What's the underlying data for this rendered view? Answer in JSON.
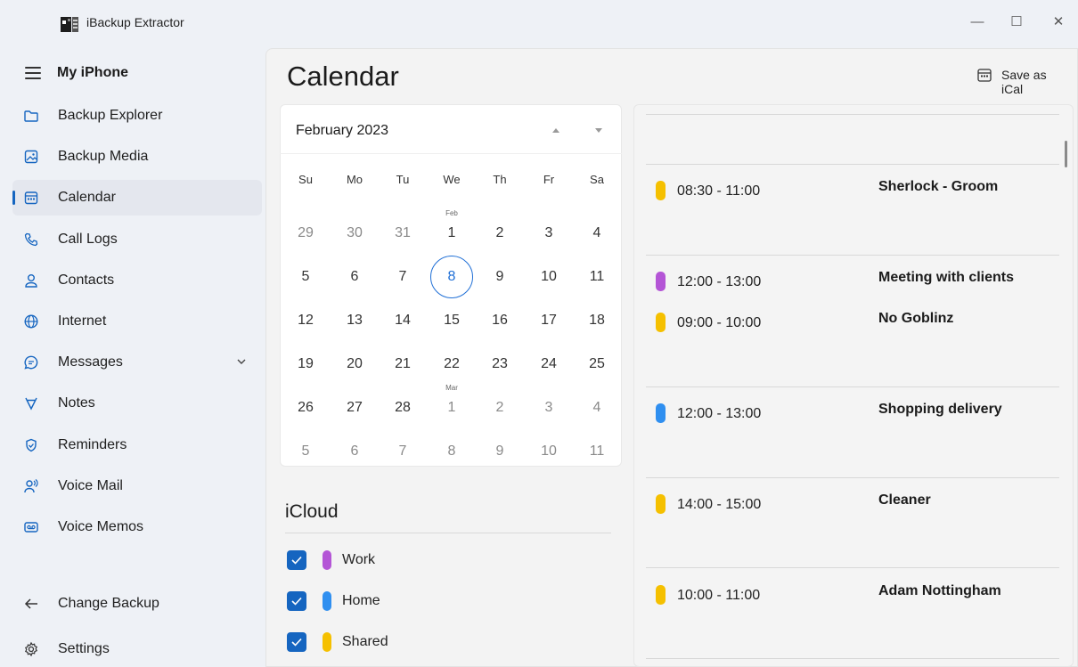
{
  "window": {
    "title": "iBackup Extractor",
    "controls": {
      "minimize": "—",
      "maximize": "☐",
      "close": "✕"
    }
  },
  "sidebar": {
    "device_name": "My iPhone",
    "items": [
      {
        "label": "Backup Explorer",
        "icon": "folder-icon"
      },
      {
        "label": "Backup Media",
        "icon": "image-icon"
      },
      {
        "label": "Calendar",
        "icon": "calendar-icon",
        "selected": true
      },
      {
        "label": "Call Logs",
        "icon": "phone-icon"
      },
      {
        "label": "Contacts",
        "icon": "person-icon"
      },
      {
        "label": "Internet",
        "icon": "globe-icon"
      },
      {
        "label": "Messages",
        "icon": "chat-icon",
        "expandable": true
      },
      {
        "label": "Notes",
        "icon": "notes-icon"
      },
      {
        "label": "Reminders",
        "icon": "reminder-icon"
      },
      {
        "label": "Voice Mail",
        "icon": "voicemail-icon"
      },
      {
        "label": "Voice Memos",
        "icon": "tape-icon"
      }
    ],
    "footer": {
      "change_backup": "Change Backup",
      "settings": "Settings"
    }
  },
  "main": {
    "title": "Calendar",
    "save_button": "Save as iCal"
  },
  "calendar": {
    "month_label": "February 2023",
    "weekdays": [
      "Su",
      "Mo",
      "Tu",
      "We",
      "Th",
      "Fr",
      "Sa"
    ],
    "weeks": [
      [
        {
          "d": "29",
          "o": true
        },
        {
          "d": "30",
          "o": true
        },
        {
          "d": "31",
          "o": true
        },
        {
          "d": "1",
          "m": "Feb"
        },
        {
          "d": "2"
        },
        {
          "d": "3"
        },
        {
          "d": "4"
        }
      ],
      [
        {
          "d": "5"
        },
        {
          "d": "6"
        },
        {
          "d": "7"
        },
        {
          "d": "8",
          "today": true
        },
        {
          "d": "9"
        },
        {
          "d": "10"
        },
        {
          "d": "11"
        }
      ],
      [
        {
          "d": "12"
        },
        {
          "d": "13"
        },
        {
          "d": "14"
        },
        {
          "d": "15"
        },
        {
          "d": "16"
        },
        {
          "d": "17"
        },
        {
          "d": "18"
        }
      ],
      [
        {
          "d": "19"
        },
        {
          "d": "20"
        },
        {
          "d": "21"
        },
        {
          "d": "22"
        },
        {
          "d": "23"
        },
        {
          "d": "24"
        },
        {
          "d": "25"
        }
      ],
      [
        {
          "d": "26"
        },
        {
          "d": "27"
        },
        {
          "d": "28"
        },
        {
          "d": "1",
          "m": "Mar",
          "o": true
        },
        {
          "d": "2",
          "o": true
        },
        {
          "d": "3",
          "o": true
        },
        {
          "d": "4",
          "o": true
        }
      ],
      [
        {
          "d": "5",
          "o": true
        },
        {
          "d": "6",
          "o": true
        },
        {
          "d": "7",
          "o": true
        },
        {
          "d": "8",
          "o": true
        },
        {
          "d": "9",
          "o": true
        },
        {
          "d": "10",
          "o": true
        },
        {
          "d": "11",
          "o": true
        }
      ]
    ]
  },
  "calendars_group": {
    "title": "iCloud",
    "items": [
      {
        "name": "Work",
        "color": "#b455d6",
        "checked": true
      },
      {
        "name": "Home",
        "color": "#2f8ff0",
        "checked": true
      },
      {
        "name": "Shared",
        "color": "#f5c000",
        "checked": true
      }
    ]
  },
  "events": [
    {
      "time": "08:30 - 11:00",
      "title": "Sherlock - Groom",
      "color": "#f5c000"
    },
    {
      "time": "12:00 - 13:00",
      "title": "Meeting with clients",
      "color": "#b455d6"
    },
    {
      "time": "09:00 - 10:00",
      "title": "No Goblinz",
      "color": "#f5c000"
    },
    {
      "time": "12:00 - 13:00",
      "title": "Shopping delivery",
      "color": "#2f8ff0"
    },
    {
      "time": "14:00 - 15:00",
      "title": "Cleaner",
      "color": "#f5c000"
    },
    {
      "time": "10:00 - 11:00",
      "title": "Adam Nottingham",
      "color": "#f5c000"
    }
  ],
  "colors": {
    "accent": "#1565c0",
    "selected_bg": "#e4e7ee"
  }
}
